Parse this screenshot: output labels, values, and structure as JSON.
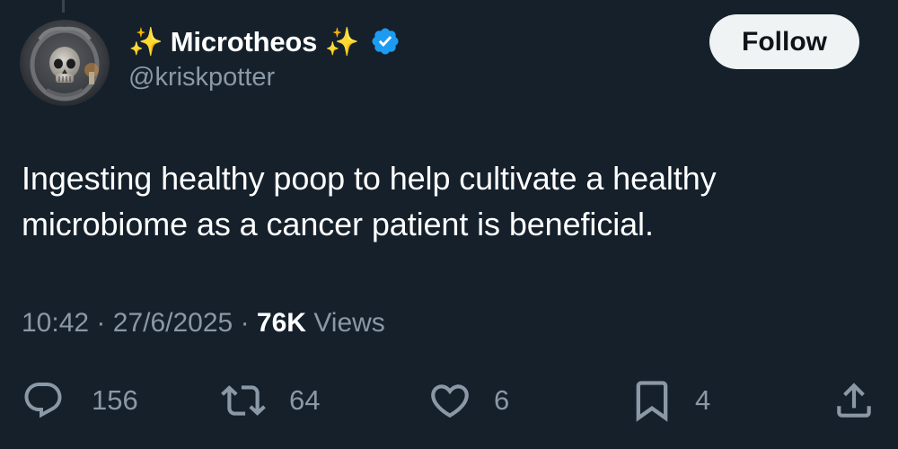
{
  "author": {
    "display_name": "✨ Microtheos ✨",
    "handle": "@kriskpotter",
    "verified": true,
    "avatar_icon": "skull-avatar"
  },
  "follow_label": "Follow",
  "tweet_text": "Ingesting healthy poop to help cultivate a healthy microbiome as a cancer patient is beneficial.",
  "meta": {
    "time": "10:42",
    "date": "27/6/2025",
    "views_count": "76K",
    "views_label": "Views",
    "separator": "·"
  },
  "actions": {
    "replies": "156",
    "reposts": "64",
    "likes": "6",
    "bookmarks": "4"
  },
  "colors": {
    "background": "#15202b",
    "text_secondary": "#8b98a5",
    "verified": "#1d9bf0",
    "follow_bg": "#eff3f4"
  }
}
